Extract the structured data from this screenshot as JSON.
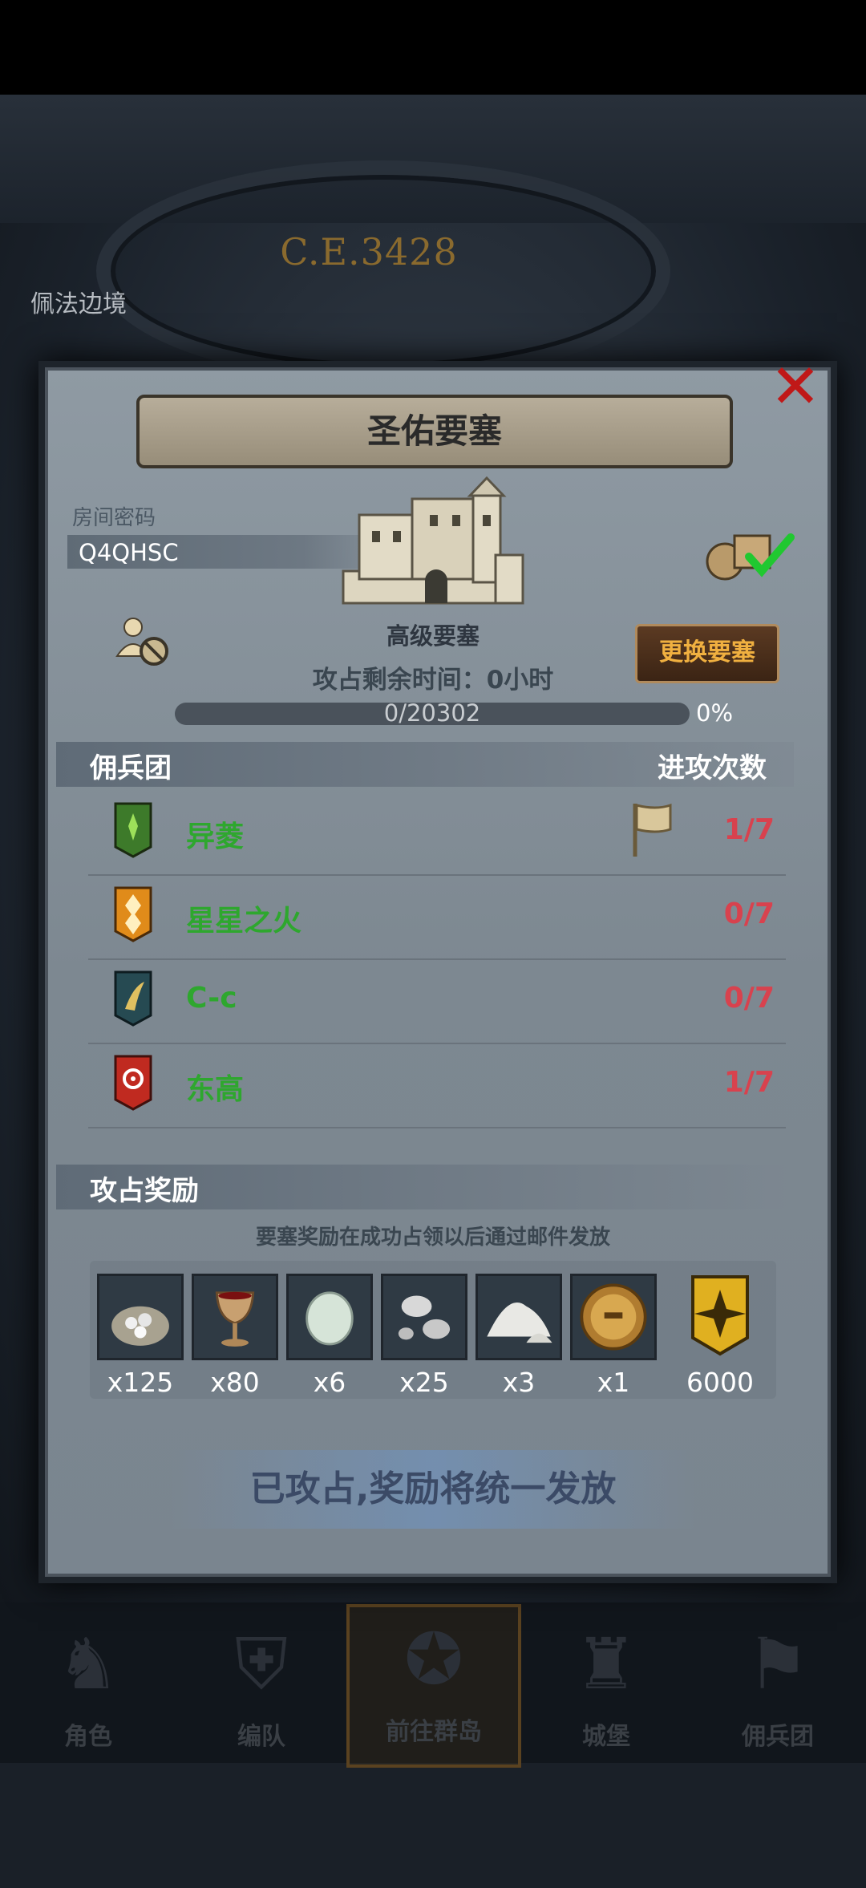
{
  "background": {
    "era": "C.E.3428",
    "region": "佩法边境"
  },
  "dialog": {
    "title": "圣佑要塞",
    "room_code_label": "房间密码",
    "room_code": "Q4QHSC",
    "fortress_name": "高级要塞",
    "change_button": "更换要塞",
    "time_remaining": "攻占剩余时间：0小时",
    "progress": {
      "text": "0/20302",
      "current": 0,
      "total": 20302,
      "percent_text": "0%"
    },
    "mercenary_header": "佣兵团",
    "attack_count_header": "进攻次数",
    "guilds": [
      {
        "name": "异菱",
        "count": "1/7",
        "banner_color": "#3d7a2a",
        "icon": "green-leaf-banner-icon",
        "flag": true
      },
      {
        "name": "星星之火",
        "count": "0/7",
        "banner_color": "#e08b1a",
        "icon": "orange-diamond-banner-icon",
        "flag": false
      },
      {
        "name": "C-c",
        "count": "0/7",
        "banner_color": "#264a52",
        "icon": "teal-bird-banner-icon",
        "flag": false
      },
      {
        "name": "东高",
        "count": "1/7",
        "banner_color": "#c02a20",
        "icon": "red-sun-banner-icon",
        "flag": false
      }
    ],
    "rewards_header": "攻占奖励",
    "rewards_note": "要塞奖励在成功占领以后通过邮件发放",
    "rewards": [
      {
        "qty": "x125",
        "icon": "silver-ore-sack-icon"
      },
      {
        "qty": "x80",
        "icon": "goblet-icon"
      },
      {
        "qty": "x6",
        "icon": "moonstone-icon"
      },
      {
        "qty": "x25",
        "icon": "silver-pebbles-icon"
      },
      {
        "qty": "x3",
        "icon": "salt-pile-icon"
      },
      {
        "qty": "x1",
        "icon": "knight-helmet-coin-icon"
      },
      {
        "qty": "6000",
        "icon": "guild-banner-token-icon"
      }
    ],
    "claim_text": "已攻占,奖励将统一发放"
  },
  "nav": {
    "items": [
      {
        "label": "角色",
        "icon": "character-icon"
      },
      {
        "label": "编队",
        "icon": "formation-icon"
      },
      {
        "label": "前往群岛",
        "icon": "islands-compass-icon"
      },
      {
        "label": "城堡",
        "icon": "castle-icon"
      },
      {
        "label": "佣兵团",
        "icon": "mercenary-icon"
      }
    ]
  }
}
